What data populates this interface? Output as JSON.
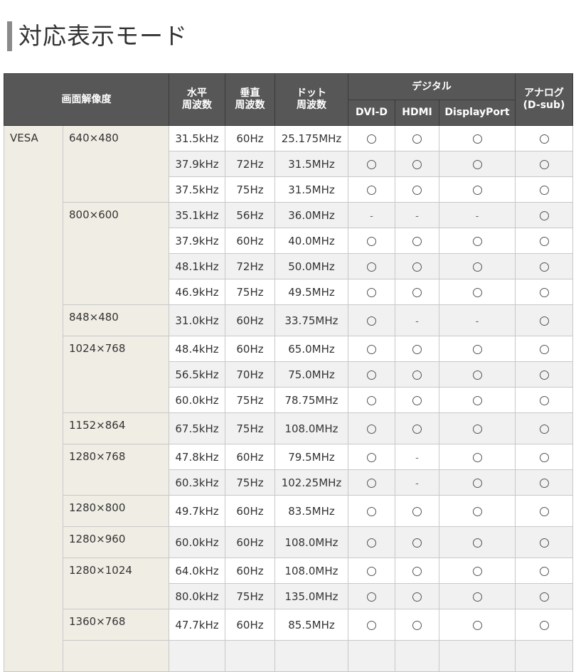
{
  "title": "対応表示モード",
  "header": {
    "resolution": "画面解像度",
    "horizontal": [
      "水平",
      "周波数"
    ],
    "vertical": [
      "垂直",
      "周波数"
    ],
    "dot": [
      "ドット",
      "周波数"
    ],
    "digital": "デジタル",
    "analog": [
      "アナログ",
      "(D-sub)"
    ],
    "dvi": "DVI-D",
    "hdmi": "HDMI",
    "dp": "DisplayPort"
  },
  "category": "VESA",
  "groups": [
    {
      "resolution": "640×480",
      "rows": [
        {
          "h": "31.5kHz",
          "v": "60Hz",
          "dot": "25.175MHz",
          "dvi": "o",
          "hdmi": "o",
          "dp": "o",
          "analog": "o"
        },
        {
          "h": "37.9kHz",
          "v": "72Hz",
          "dot": "31.5MHz",
          "dvi": "o",
          "hdmi": "o",
          "dp": "o",
          "analog": "o"
        },
        {
          "h": "37.5kHz",
          "v": "75Hz",
          "dot": "31.5MHz",
          "dvi": "o",
          "hdmi": "o",
          "dp": "o",
          "analog": "o"
        }
      ]
    },
    {
      "resolution": "800×600",
      "rows": [
        {
          "h": "35.1kHz",
          "v": "56Hz",
          "dot": "36.0MHz",
          "dvi": "-",
          "hdmi": "-",
          "dp": "-",
          "analog": "o"
        },
        {
          "h": "37.9kHz",
          "v": "60Hz",
          "dot": "40.0MHz",
          "dvi": "o",
          "hdmi": "o",
          "dp": "o",
          "analog": "o"
        },
        {
          "h": "48.1kHz",
          "v": "72Hz",
          "dot": "50.0MHz",
          "dvi": "o",
          "hdmi": "o",
          "dp": "o",
          "analog": "o"
        },
        {
          "h": "46.9kHz",
          "v": "75Hz",
          "dot": "49.5MHz",
          "dvi": "o",
          "hdmi": "o",
          "dp": "o",
          "analog": "o"
        }
      ]
    },
    {
      "resolution": "848×480",
      "rows": [
        {
          "h": "31.0kHz",
          "v": "60Hz",
          "dot": "33.75MHz",
          "dvi": "o",
          "hdmi": "-",
          "dp": "-",
          "analog": "o"
        }
      ]
    },
    {
      "resolution": "1024×768",
      "rows": [
        {
          "h": "48.4kHz",
          "v": "60Hz",
          "dot": "65.0MHz",
          "dvi": "o",
          "hdmi": "o",
          "dp": "o",
          "analog": "o"
        },
        {
          "h": "56.5kHz",
          "v": "70Hz",
          "dot": "75.0MHz",
          "dvi": "o",
          "hdmi": "o",
          "dp": "o",
          "analog": "o"
        },
        {
          "h": "60.0kHz",
          "v": "75Hz",
          "dot": "78.75MHz",
          "dvi": "o",
          "hdmi": "o",
          "dp": "o",
          "analog": "o"
        }
      ]
    },
    {
      "resolution": "1152×864",
      "rows": [
        {
          "h": "67.5kHz",
          "v": "75Hz",
          "dot": "108.0MHz",
          "dvi": "o",
          "hdmi": "o",
          "dp": "o",
          "analog": "o"
        }
      ]
    },
    {
      "resolution": "1280×768",
      "rows": [
        {
          "h": "47.8kHz",
          "v": "60Hz",
          "dot": "79.5MHz",
          "dvi": "o",
          "hdmi": "-",
          "dp": "o",
          "analog": "o"
        },
        {
          "h": "60.3kHz",
          "v": "75Hz",
          "dot": "102.25MHz",
          "dvi": "o",
          "hdmi": "-",
          "dp": "o",
          "analog": "o"
        }
      ]
    },
    {
      "resolution": "1280×800",
      "rows": [
        {
          "h": "49.7kHz",
          "v": "60Hz",
          "dot": "83.5MHz",
          "dvi": "o",
          "hdmi": "o",
          "dp": "o",
          "analog": "o"
        }
      ]
    },
    {
      "resolution": "1280×960",
      "rows": [
        {
          "h": "60.0kHz",
          "v": "60Hz",
          "dot": "108.0MHz",
          "dvi": "o",
          "hdmi": "o",
          "dp": "o",
          "analog": "o"
        }
      ]
    },
    {
      "resolution": "1280×1024",
      "rows": [
        {
          "h": "64.0kHz",
          "v": "60Hz",
          "dot": "108.0MHz",
          "dvi": "o",
          "hdmi": "o",
          "dp": "o",
          "analog": "o"
        },
        {
          "h": "80.0kHz",
          "v": "75Hz",
          "dot": "135.0MHz",
          "dvi": "o",
          "hdmi": "o",
          "dp": "o",
          "analog": "o"
        }
      ]
    },
    {
      "resolution": "1360×768",
      "rows": [
        {
          "h": "47.7kHz",
          "v": "60Hz",
          "dot": "85.5MHz",
          "dvi": "o",
          "hdmi": "o",
          "dp": "o",
          "analog": "o"
        }
      ]
    }
  ]
}
